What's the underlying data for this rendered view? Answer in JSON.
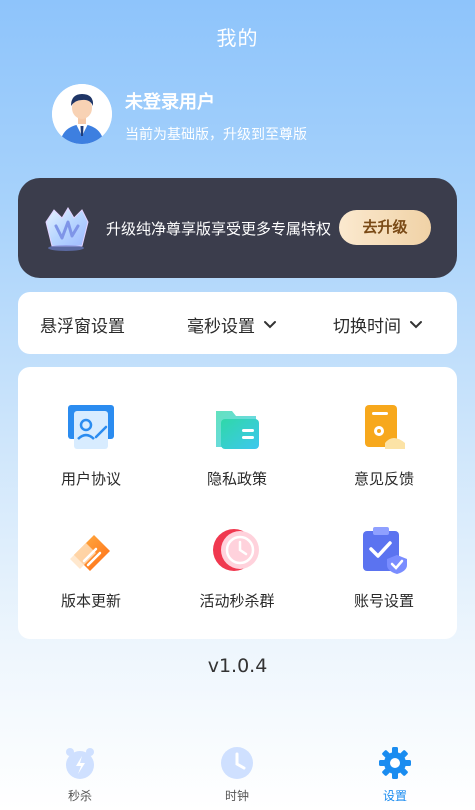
{
  "header": {
    "title": "我的"
  },
  "profile": {
    "name": "未登录用户",
    "subtitle": "当前为基础版，升级到至尊版"
  },
  "vip_banner": {
    "text": "升级纯净尊享版享受更多专属特权",
    "button": "去升级"
  },
  "settings_row": {
    "float_window": "悬浮窗设置",
    "ms_setting": "毫秒设置",
    "switch_time": "切换时间"
  },
  "menu": [
    {
      "label": "用户协议",
      "icon": "user-agreement-icon"
    },
    {
      "label": "隐私政策",
      "icon": "privacy-policy-icon"
    },
    {
      "label": "意见反馈",
      "icon": "feedback-icon"
    },
    {
      "label": "版本更新",
      "icon": "version-update-icon"
    },
    {
      "label": "活动秒杀群",
      "icon": "flash-sale-group-icon"
    },
    {
      "label": "账号设置",
      "icon": "account-settings-icon"
    }
  ],
  "version": "v1.0.4",
  "tabs": [
    {
      "label": "秒杀",
      "icon": "alarm-flash-icon",
      "active": false
    },
    {
      "label": "时钟",
      "icon": "clock-icon",
      "active": false
    },
    {
      "label": "设置",
      "icon": "gear-icon",
      "active": true
    }
  ],
  "colors": {
    "accent": "#1a8cf0",
    "banner_bg": "#3b3d4c",
    "button_gold": "#f0d2a6"
  }
}
